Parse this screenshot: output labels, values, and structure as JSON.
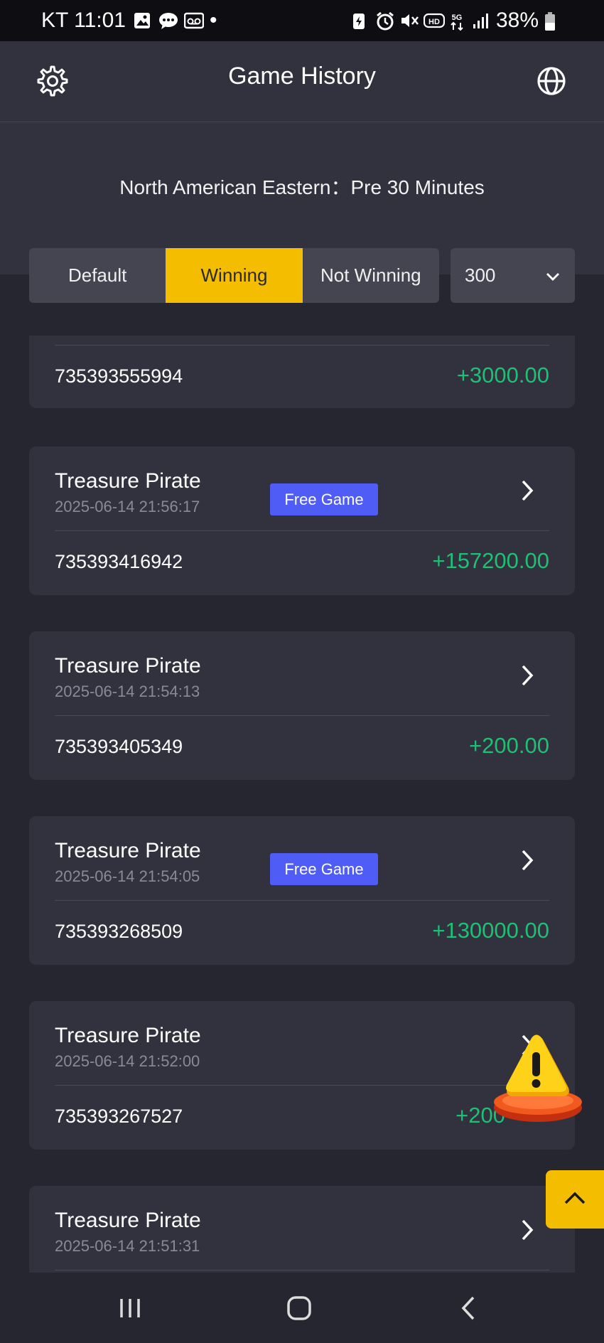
{
  "status_bar": {
    "carrier_time": "KT 11:01",
    "dot": "•",
    "battery": "38%",
    "icons_left": [
      "gallery-icon",
      "chat-icon",
      "voicemail-icon"
    ],
    "icons_right": [
      "battery-saver-icon",
      "alarm-icon",
      "mute-icon",
      "hd-icon",
      "5g-icon",
      "signal-icon",
      "battery-icon"
    ]
  },
  "header": {
    "title": "Game History",
    "left_icon": "gear-icon",
    "right_icon": "globe-icon"
  },
  "timezone": "North American Eastern：Pre 30 Minutes",
  "filters": {
    "options": [
      "Default",
      "Winning",
      "Not Winning"
    ],
    "active": "Winning",
    "count": "300"
  },
  "records": [
    {
      "name": "",
      "date": "",
      "free_game": false,
      "order_id": "735393555994",
      "amount": "+3000.00"
    },
    {
      "name": "Treasure Pirate",
      "date": "2025-06-14 21:56:17",
      "free_game": true,
      "badge": "Free Game",
      "order_id": "735393416942",
      "amount": "+157200.00"
    },
    {
      "name": "Treasure Pirate",
      "date": "2025-06-14 21:54:13",
      "free_game": false,
      "order_id": "735393405349",
      "amount": "+200.00"
    },
    {
      "name": "Treasure Pirate",
      "date": "2025-06-14 21:54:05",
      "free_game": true,
      "badge": "Free Game",
      "order_id": "735393268509",
      "amount": "+130000.00"
    },
    {
      "name": "Treasure Pirate",
      "date": "2025-06-14 21:52:00",
      "free_game": false,
      "order_id": "735393267527",
      "amount": "+200"
    },
    {
      "name": "Treasure Pirate",
      "date": "2025-06-14 21:51:31",
      "free_game": false,
      "order_id": "",
      "amount": ""
    }
  ],
  "colors": {
    "accent": "#f5bd00",
    "win_green": "#1fbf74",
    "badge_blue": "#4f5cf5",
    "card_bg": "#32323e",
    "page_bg": "#262630"
  }
}
